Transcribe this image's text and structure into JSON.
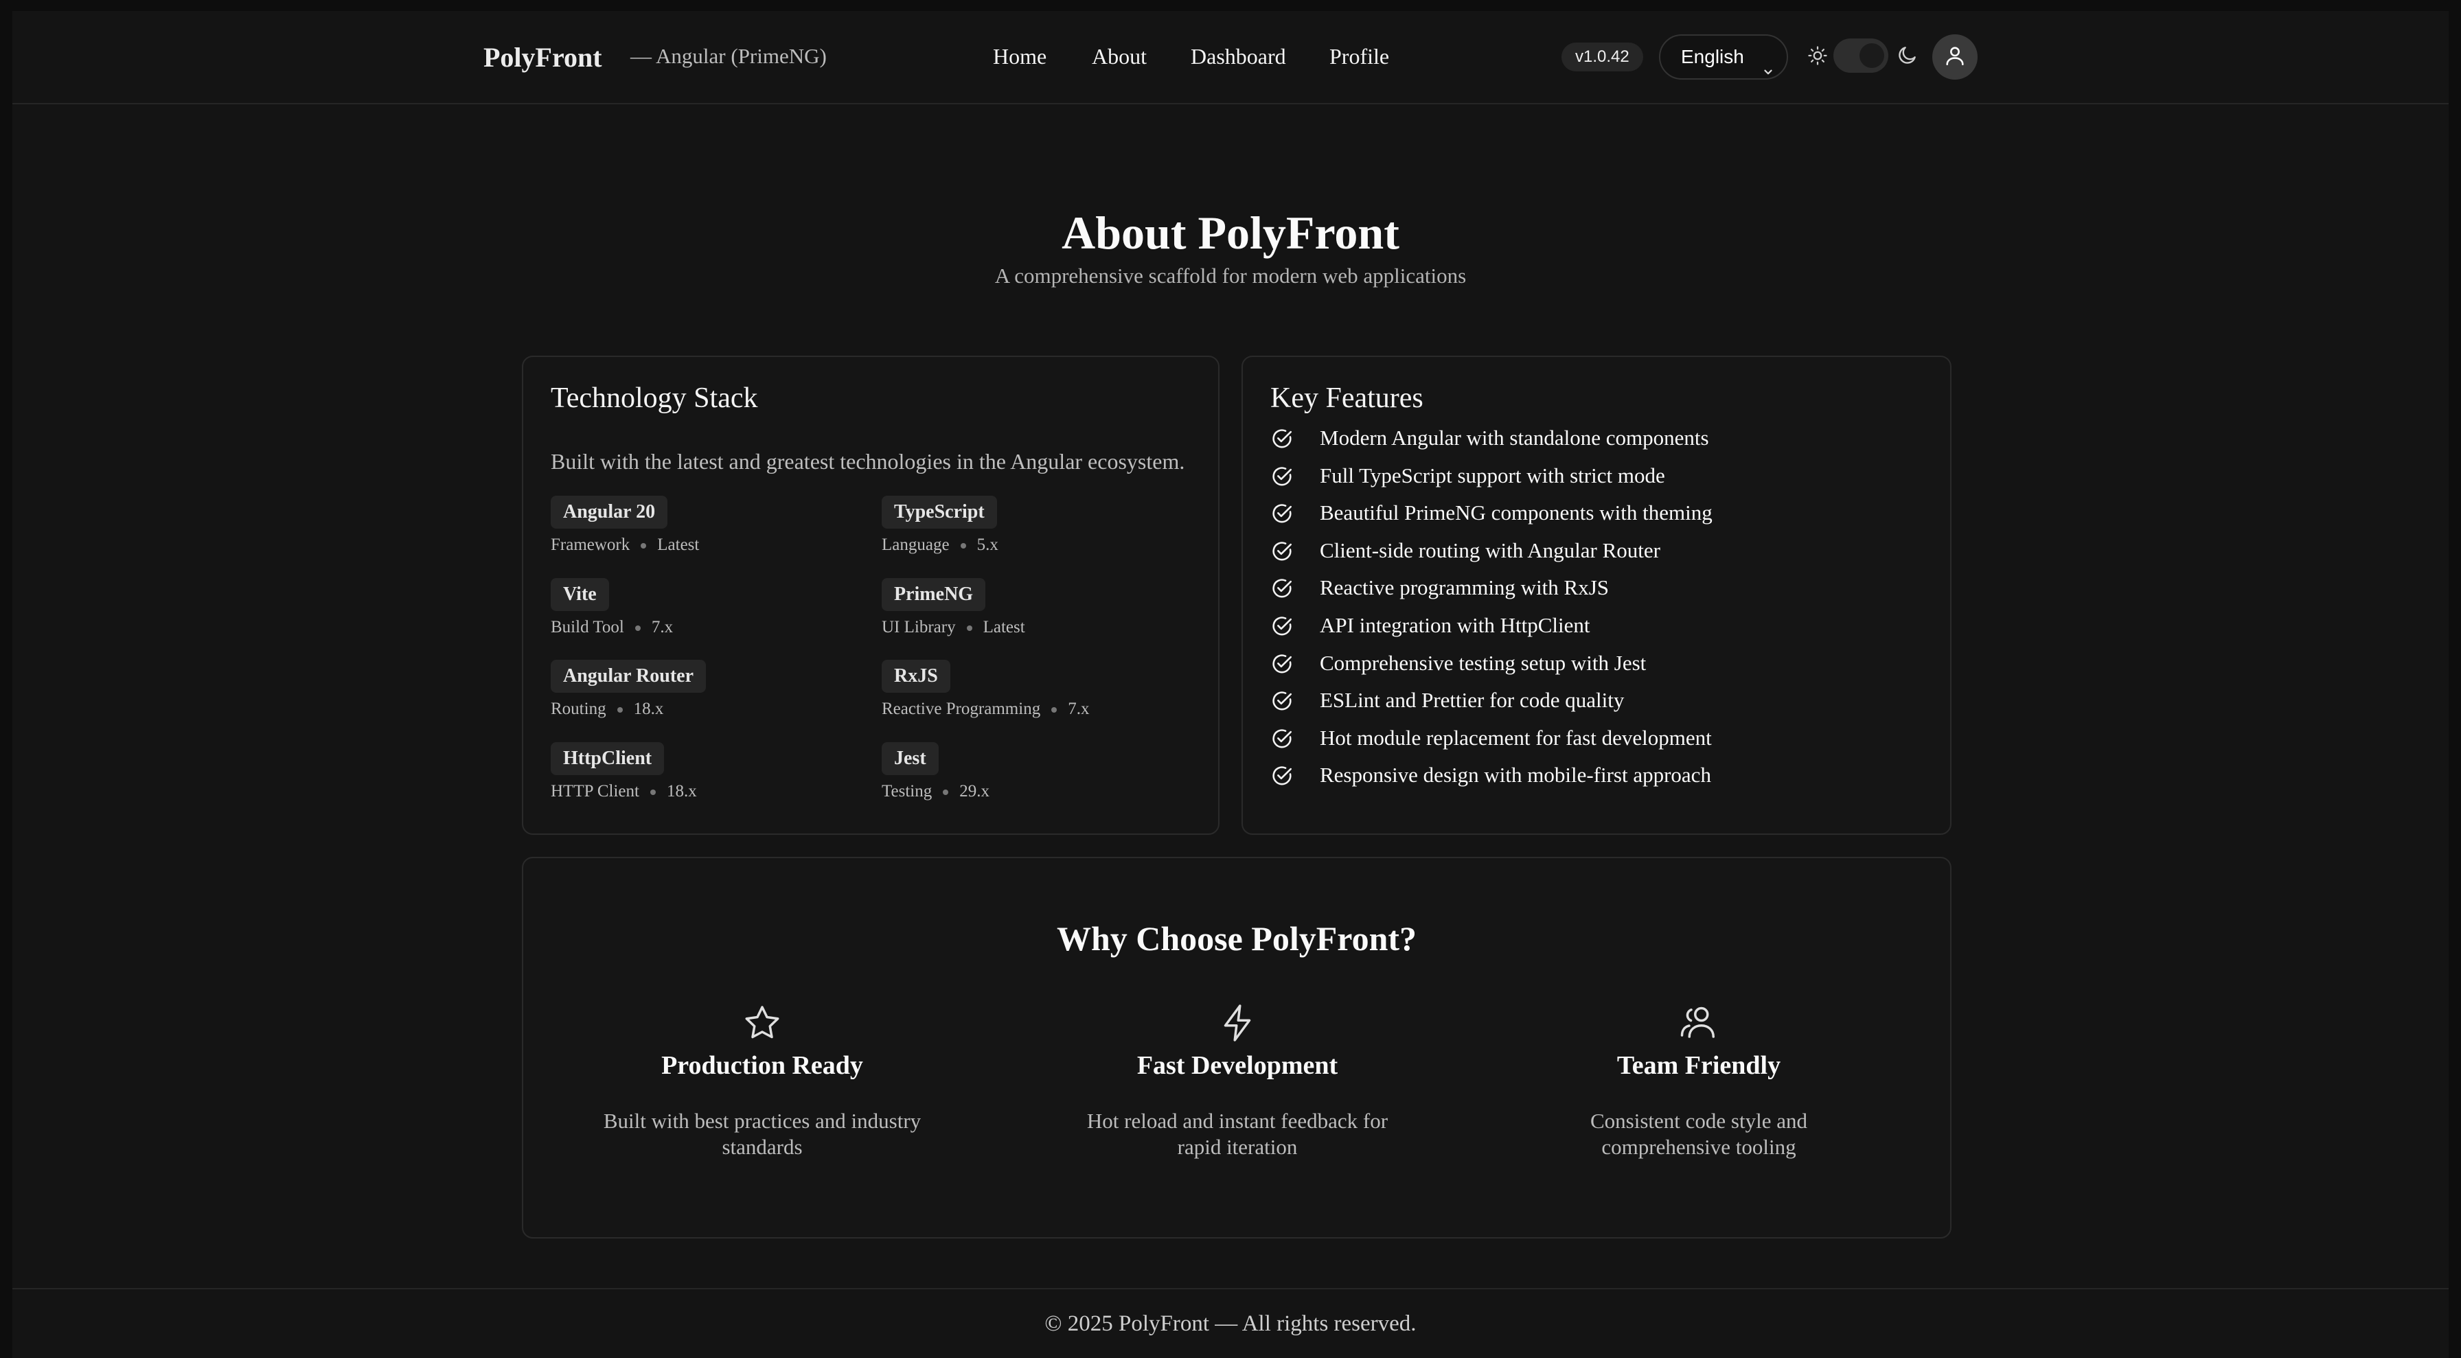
{
  "header": {
    "brand": "PolyFront",
    "subtitle": "— Angular (PrimeNG)",
    "nav": [
      "Home",
      "About",
      "Dashboard",
      "Profile"
    ],
    "version": "v1.0.42",
    "language": "English",
    "icons": {
      "language_chevron": "chevron-down-icon",
      "light": "sun-icon",
      "dark": "moon-icon",
      "user": "user-icon"
    }
  },
  "hero": {
    "title": "About PolyFront",
    "subtitle": "A comprehensive scaffold for modern web applications"
  },
  "tech_stack": {
    "title": "Technology Stack",
    "description": "Built with the latest and greatest technologies in the Angular ecosystem.",
    "items": [
      {
        "name": "Angular 20",
        "category": "Framework",
        "version": "Latest"
      },
      {
        "name": "TypeScript",
        "category": "Language",
        "version": "5.x"
      },
      {
        "name": "Vite",
        "category": "Build Tool",
        "version": "7.x"
      },
      {
        "name": "PrimeNG",
        "category": "UI Library",
        "version": "Latest"
      },
      {
        "name": "Angular Router",
        "category": "Routing",
        "version": "18.x"
      },
      {
        "name": "RxJS",
        "category": "Reactive Programming",
        "version": "7.x"
      },
      {
        "name": "HttpClient",
        "category": "HTTP Client",
        "version": "18.x"
      },
      {
        "name": "Jest",
        "category": "Testing",
        "version": "29.x"
      }
    ]
  },
  "features": {
    "title": "Key Features",
    "icon": "check-circle-icon",
    "items": [
      "Modern Angular with standalone components",
      "Full TypeScript support with strict mode",
      "Beautiful PrimeNG components with theming",
      "Client-side routing with Angular Router",
      "Reactive programming with RxJS",
      "API integration with HttpClient",
      "Comprehensive testing setup with Jest",
      "ESLint and Prettier for code quality",
      "Hot module replacement for fast development",
      "Responsive design with mobile-first approach"
    ]
  },
  "why": {
    "title": "Why Choose PolyFront?",
    "items": [
      {
        "icon": "star-icon",
        "title": "Production Ready",
        "description": "Built with best practices and industry standards"
      },
      {
        "icon": "lightning-icon",
        "title": "Fast Development",
        "description": "Hot reload and instant feedback for rapid iteration"
      },
      {
        "icon": "team-icon",
        "title": "Team Friendly",
        "description": "Consistent code style and comprehensive tooling"
      }
    ]
  },
  "footer": {
    "text": "© 2025 PolyFront — All rights reserved."
  }
}
